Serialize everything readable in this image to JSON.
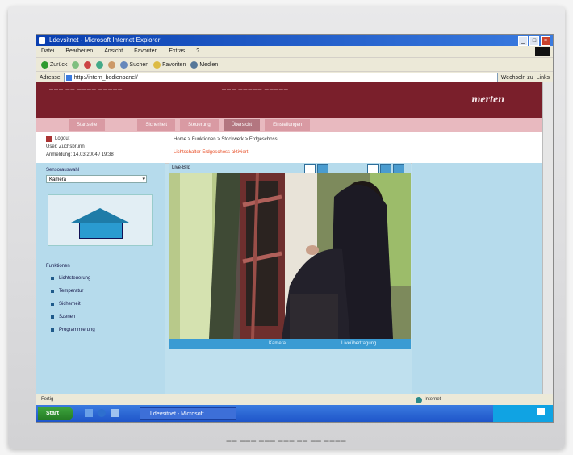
{
  "browser": {
    "title": "Ldevsitnet - Microsoft Internet Explorer",
    "menu": [
      "Datei",
      "Bearbeiten",
      "Ansicht",
      "Favoriten",
      "Extras",
      "?"
    ],
    "toolbar": [
      "Zurück",
      "Suchen",
      "Favoriten",
      "Medien"
    ],
    "address_label": "Adresse",
    "address_value": "http://intern_bedienpanel/",
    "go_label": "Wechseln zu",
    "links_label": "Links"
  },
  "site": {
    "brand": "merten",
    "nav": [
      "Startseite",
      "Sicherheit",
      "Steuerung",
      "Übersicht",
      "Einstellungen"
    ],
    "login": "Logout",
    "user": "User: Zuchsbrunn",
    "timestamp": "Anmeldung: 14.03.2004 / 19:38",
    "breadcrumb": "Home > Funktionen > Stockwerk > Erdgeschoss",
    "alert": "Lichtschalter Erdgeschoss aktiviert"
  },
  "sidebar": {
    "title": "Sensorauswahl",
    "select_value": "Kamera",
    "heading": "Funktionen",
    "items": [
      "Lichtsteuerung",
      "Temperatur",
      "Sicherheit",
      "Szenen",
      "Programmierung"
    ]
  },
  "main": {
    "video_title": "Live-Bild",
    "vbar_left": "Kamera",
    "vbar_right": "Liveübertragung"
  },
  "status": {
    "left": "Fertig",
    "right": "Internet"
  },
  "taskbar": {
    "start": "Start",
    "item": "Ldevsitnet - Microsoft..."
  },
  "colors": {
    "banner": "#7a1f2b",
    "nav": "#e8b9bf",
    "panel": "#b6dbec",
    "accent": "#3a9bd3"
  }
}
